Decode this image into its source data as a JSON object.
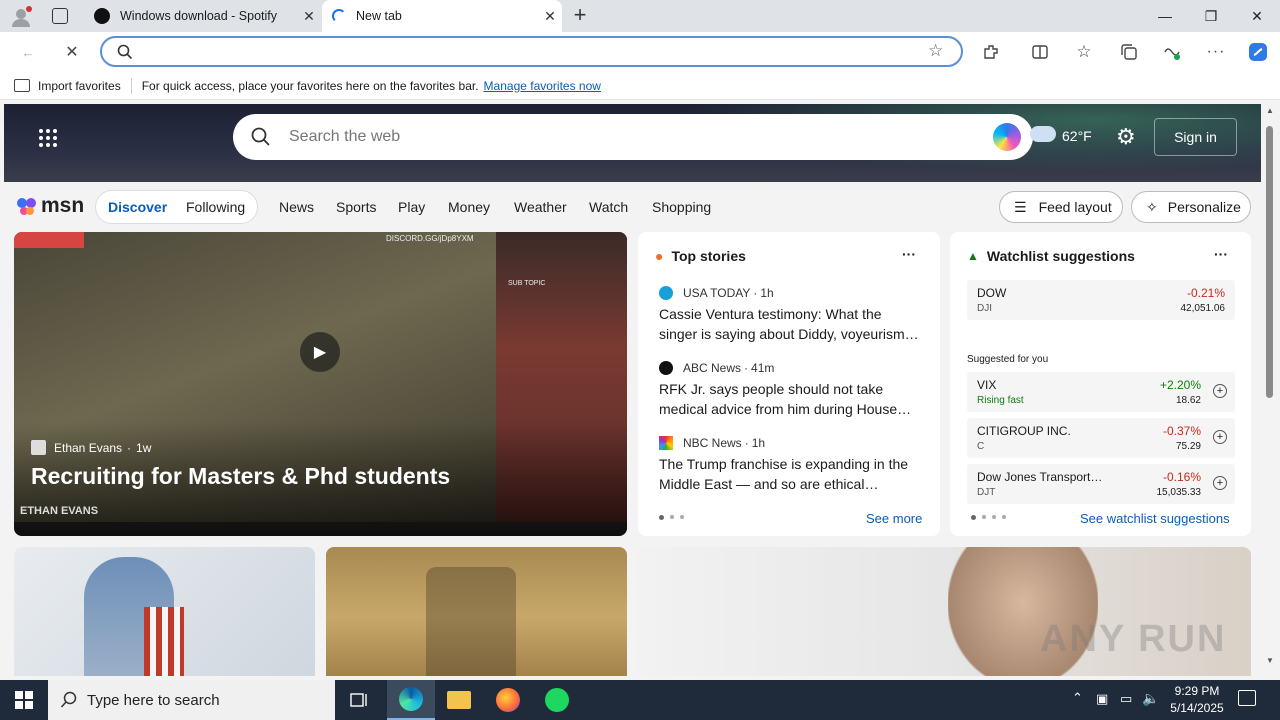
{
  "browser": {
    "tabs": [
      {
        "title": "Windows download - Spotify"
      },
      {
        "title": "New tab"
      }
    ],
    "favorites_bar": {
      "import_label": "Import favorites",
      "message": "For quick access, place your favorites here on the favorites bar.",
      "manage_link": "Manage favorites now"
    }
  },
  "msn": {
    "search_placeholder": "Search the web",
    "temperature": "62°F",
    "sign_in": "Sign in",
    "logo": "msn",
    "toggle": [
      "Discover",
      "Following"
    ],
    "nav": [
      "News",
      "Sports",
      "Play",
      "Money",
      "Weather",
      "Watch",
      "Shopping"
    ],
    "feed_layout": "Feed layout",
    "personalize": "Personalize",
    "hero": {
      "author": "Ethan Evans",
      "age": "1w",
      "title": "Recruiting for Masters & Phd students",
      "overlay_text": "DISCORD.GG/jDp8YXM",
      "sub_topic": "SUB TOPIC",
      "watermark": "ETHAN EVANS"
    },
    "top_stories": {
      "title": "Top stories",
      "items": [
        {
          "source": "USA TODAY",
          "age": "1h",
          "headline": "Cassie Ventura testimony: What the singer is saying about Diddy, voyeurism…"
        },
        {
          "source": "ABC News",
          "age": "41m",
          "headline": "RFK Jr. says people should not take medical advice from him during House…"
        },
        {
          "source": "NBC News",
          "age": "1h",
          "headline": "The Trump franchise is expanding in the Middle East — and so are ethical…"
        }
      ],
      "see_more": "See more"
    },
    "watchlist": {
      "title": "Watchlist suggestions",
      "dow": {
        "name": "DOW",
        "ticker": "DJI",
        "change": "-0.21%",
        "value": "42,051.06"
      },
      "suggested_label": "Suggested for you",
      "items": [
        {
          "name": "VIX",
          "sub": "Rising fast",
          "change": "+2.20%",
          "value": "18.62"
        },
        {
          "name": "CITIGROUP INC.",
          "sub": "C",
          "change": "-0.37%",
          "value": "75.29"
        },
        {
          "name": "Dow Jones Transport…",
          "sub": "DJT",
          "change": "-0.16%",
          "value": "15,035.33"
        }
      ],
      "see_link": "See watchlist suggestions"
    }
  },
  "taskbar": {
    "search_placeholder": "Type here to search",
    "time": "9:29 PM",
    "date": "5/14/2025"
  },
  "watermark": "ANY RUN",
  "colors": {
    "accent": "#0a5cb8",
    "negative": "#c42b1c",
    "positive": "#107c10"
  }
}
